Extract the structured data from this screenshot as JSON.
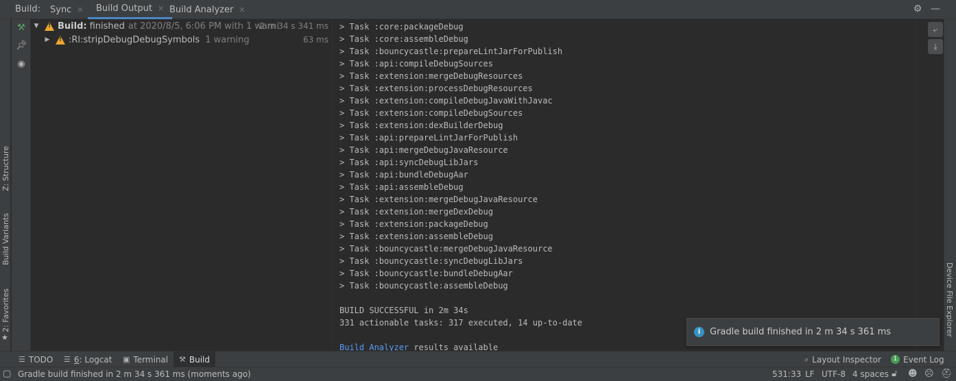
{
  "topbar": {
    "build_label": "Build:",
    "tabs": [
      {
        "label": "Sync"
      },
      {
        "label": "Build Output"
      },
      {
        "label": "Build Analyzer"
      }
    ]
  },
  "left_strip": {
    "structure": "Z: Structure",
    "build_variants": "Build Variants",
    "favorites": "2: Favorites"
  },
  "right_strip": {
    "device_file_explorer": "Device File Explorer"
  },
  "tree": {
    "root": {
      "title_bold": "Build:",
      "title": "finished",
      "detail": "at 2020/8/5, 6:06 PM with 1 warni",
      "time": "2 m 34 s 341 ms"
    },
    "child": {
      "title": ":Rl:stripDebugDebugSymbols",
      "detail": "1 warning",
      "time": "63 ms"
    }
  },
  "console": {
    "lines": [
      "> Task :core:packageDebug",
      "> Task :core:assembleDebug",
      "> Task :bouncycastle:prepareLintJarForPublish",
      "> Task :api:compileDebugSources",
      "> Task :extension:mergeDebugResources",
      "> Task :extension:processDebugResources",
      "> Task :extension:compileDebugJavaWithJavac",
      "> Task :extension:compileDebugSources",
      "> Task :extension:dexBuilderDebug",
      "> Task :api:prepareLintJarForPublish",
      "> Task :api:mergeDebugJavaResource",
      "> Task :api:syncDebugLibJars",
      "> Task :api:bundleDebugAar",
      "> Task :api:assembleDebug",
      "> Task :extension:mergeDebugJavaResource",
      "> Task :extension:mergeDexDebug",
      "> Task :extension:packageDebug",
      "> Task :extension:assembleDebug",
      "> Task :bouncycastle:mergeDebugJavaResource",
      "> Task :bouncycastle:syncDebugLibJars",
      "> Task :bouncycastle:bundleDebugAar",
      "> Task :bouncycastle:assembleDebug"
    ],
    "success": "BUILD SUCCESSFUL in 2m 34s",
    "summary": "331 actionable tasks: 317 executed, 14 up-to-date",
    "analyzer_link": "Build Analyzer",
    "analyzer_rest": " results available"
  },
  "notification": {
    "text": "Gradle build finished in 2 m 34 s 361 ms"
  },
  "bottombar": {
    "todo": "TODO",
    "logcat_num": "6",
    "logcat": ": Logcat",
    "terminal": "Terminal",
    "build": "Build",
    "layout_inspector": "Layout Inspector",
    "event_badge": "1",
    "event_log": "Event Log"
  },
  "statusbar": {
    "message": "Gradle build finished in 2 m 34 s 361 ms (moments ago)",
    "position": "531:33",
    "line_sep": "LF",
    "encoding": "UTF-8",
    "indent": "4 spaces"
  },
  "colors": {
    "accent": "#4a88c7",
    "warning": "#f0a732",
    "link": "#589df6",
    "info": "#3592c4",
    "event_badge": "#499c54"
  }
}
